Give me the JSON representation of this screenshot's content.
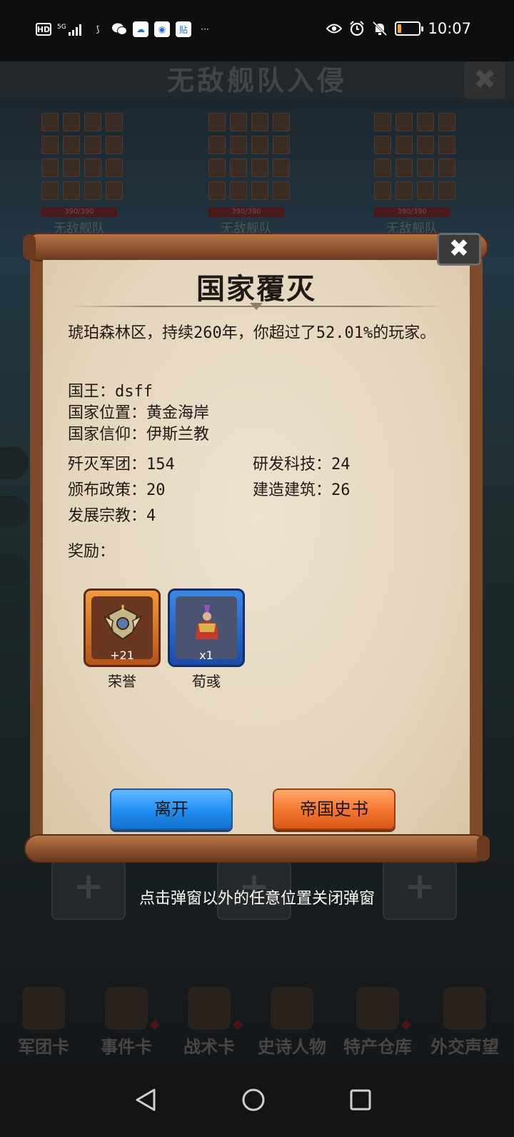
{
  "status_bar": {
    "network_hd": "HD",
    "network_sig": "5G",
    "time": "10:07",
    "battery_level": 0.18,
    "more": "···"
  },
  "background": {
    "title": "无敌舰队入侵",
    "close": "✖",
    "fleet_cards": [
      {
        "bar": "390/390",
        "label": "无敌舰队"
      },
      {
        "bar": "390/390",
        "label": "无敌舰队"
      },
      {
        "bar": "390/390",
        "label": "无敌舰队"
      }
    ],
    "plus_slots": [
      "+",
      "+",
      "+"
    ],
    "tabs": [
      {
        "label": "军团卡"
      },
      {
        "label": "事件卡"
      },
      {
        "label": "战术卡"
      },
      {
        "label": "史诗人物"
      },
      {
        "label": "特产仓库"
      },
      {
        "label": "外交声望"
      }
    ]
  },
  "dialog": {
    "title": "国家覆灭",
    "close": "✖",
    "summary": "琥珀森林区，持续260年，你超过了52.01%的玩家。",
    "king": "国王：dsff",
    "location": "国家位置：黄金海岸",
    "faith": "国家信仰：伊斯兰教",
    "stats": [
      {
        "text": "歼灭军团：154"
      },
      {
        "text": "研发科技：24"
      },
      {
        "text": "颁布政策：20"
      },
      {
        "text": "建造建筑：26"
      },
      {
        "text": "发展宗教：4"
      }
    ],
    "rewards_label": "奖励：",
    "rewards": [
      {
        "qty": "+21",
        "name": "荣誉",
        "color": "#e07a2a"
      },
      {
        "qty": "x1",
        "name": "荀彧",
        "color": "#2a6fd6"
      }
    ],
    "leave_button": "离开",
    "history_button": "帝国史书"
  },
  "hint": "点击弹窗以外的任意位置关闭弹窗",
  "colors": {
    "paper": "#e8dcc6",
    "wood": "#8a4f2c",
    "blue_button": "#1e8df0",
    "orange_button": "#f3732d"
  }
}
